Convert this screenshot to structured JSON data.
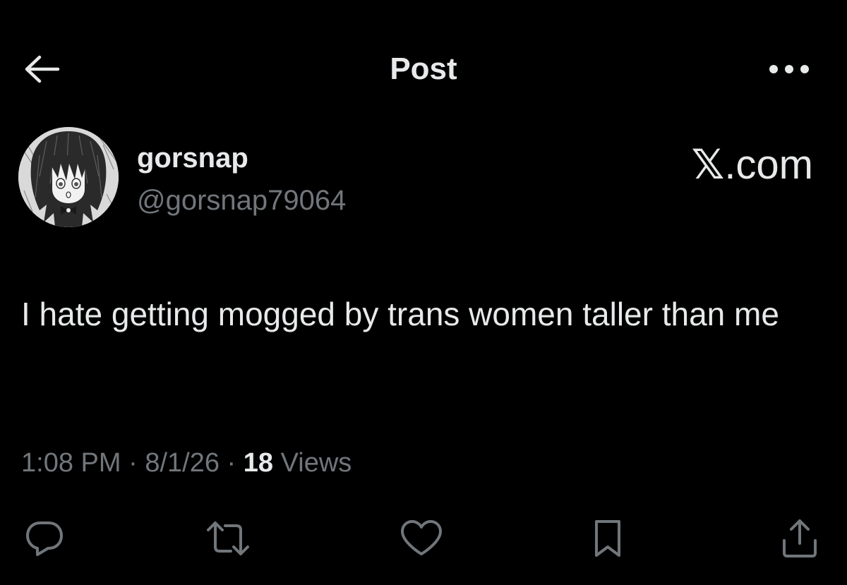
{
  "header": {
    "title": "Post",
    "back_icon": "arrow-left-icon",
    "more_icon": "more-horizontal-icon"
  },
  "author": {
    "display_name": "gorsnap",
    "handle": "@gorsnap79064",
    "avatar_icon": "anime-avatar"
  },
  "source": {
    "x_glyph": "𝕏",
    "domain": ".com"
  },
  "post": {
    "text": "I hate getting mogged by trans women taller than me"
  },
  "meta": {
    "time": "1:08 PM",
    "sep1": " · ",
    "date": "8/1/26",
    "sep2": " · ",
    "views_count": "18",
    "views_label": " Views"
  },
  "actions": [
    {
      "icon": "reply-icon"
    },
    {
      "icon": "repost-icon"
    },
    {
      "icon": "like-icon"
    },
    {
      "icon": "bookmark-icon"
    },
    {
      "icon": "share-icon"
    }
  ],
  "colors": {
    "background": "#000000",
    "text_primary": "#e7e9ea",
    "text_secondary": "#71767b"
  }
}
